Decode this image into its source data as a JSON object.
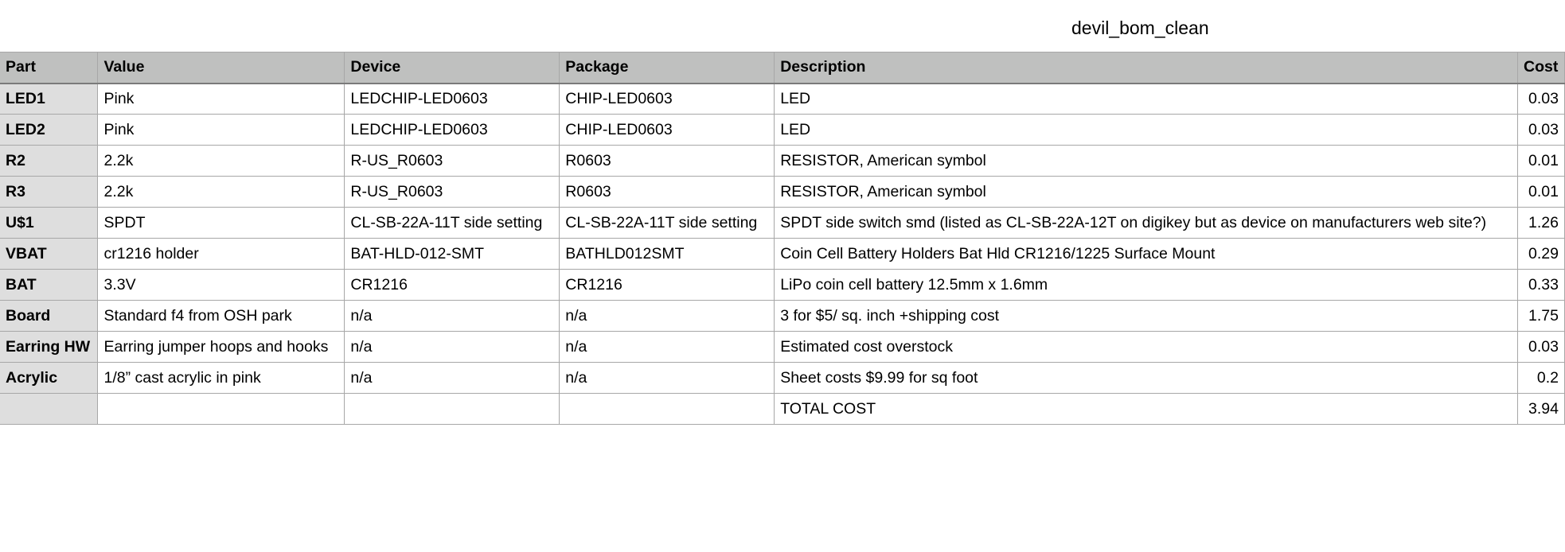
{
  "sheet": {
    "title": "devil_bom_clean"
  },
  "table": {
    "headers": {
      "part": "Part",
      "value": "Value",
      "device": "Device",
      "package": "Package",
      "description": "Description",
      "cost": "Cost"
    },
    "rows": [
      {
        "part": "LED1",
        "value": "Pink",
        "device": "LEDCHIP-LED0603",
        "package": "CHIP-LED0603",
        "description": "LED",
        "cost": "0.03"
      },
      {
        "part": "LED2",
        "value": "Pink",
        "device": "LEDCHIP-LED0603",
        "package": "CHIP-LED0603",
        "description": "LED",
        "cost": "0.03"
      },
      {
        "part": "R2",
        "value": "2.2k",
        "device": "R-US_R0603",
        "package": "R0603",
        "description": "RESISTOR, American symbol",
        "cost": "0.01"
      },
      {
        "part": "R3",
        "value": "2.2k",
        "device": "R-US_R0603",
        "package": "R0603",
        "description": "RESISTOR, American symbol",
        "cost": "0.01"
      },
      {
        "part": "U$1",
        "value": "SPDT",
        "device": "CL-SB-22A-11T side setting",
        "package": "CL-SB-22A-11T side setting",
        "description": "SPDT side switch smd (listed as CL-SB-22A-12T on digikey but as device on manufacturers web site?)",
        "cost": "1.26"
      },
      {
        "part": "VBAT",
        "value": "cr1216 holder",
        "device": "BAT-HLD-012-SMT",
        "package": "BATHLD012SMT",
        "description": "Coin Cell Battery Holders Bat Hld CR1216/1225 Surface Mount",
        "cost": "0.29"
      },
      {
        "part": "BAT",
        "value": "3.3V",
        "device": "CR1216",
        "package": "CR1216",
        "description": "LiPo coin cell battery 12.5mm x 1.6mm",
        "cost": "0.33"
      },
      {
        "part": "Board",
        "value": "Standard f4 from OSH park",
        "device": "n/a",
        "package": "n/a",
        "description": "3 for $5/ sq. inch +shipping cost",
        "cost": "1.75"
      },
      {
        "part": "Earring HW",
        "value": "Earring jumper hoops and hooks",
        "device": "n/a",
        "package": "n/a",
        "description": "Estimated cost overstock",
        "cost": "0.03"
      },
      {
        "part": "Acrylic",
        "value": "1/8” cast acrylic in pink",
        "device": "n/a",
        "package": "n/a",
        "description": "Sheet costs $9.99 for sq foot",
        "cost": "0.2"
      },
      {
        "part": "",
        "value": "",
        "device": "",
        "package": "",
        "description": "TOTAL COST",
        "cost": "3.94"
      }
    ]
  },
  "colors": {
    "header_bg": "#bfc0bf",
    "part_column_bg": "#dedede",
    "grid_line": "#a7a7a7"
  }
}
